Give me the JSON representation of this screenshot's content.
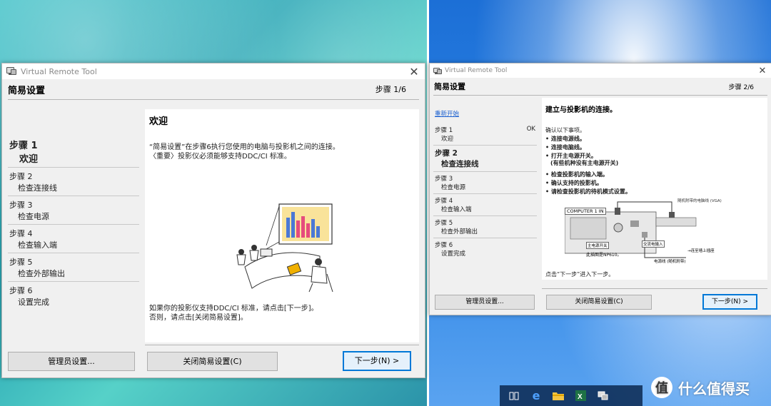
{
  "window_left": {
    "title": "Virtual Remote Tool",
    "header": "简易设置",
    "step_count": "步骤 1/6",
    "sidebar": [
      {
        "step": "步骤 1",
        "label": "欢迎",
        "active": true
      },
      {
        "step": "步骤 2",
        "label": "检查连接线"
      },
      {
        "step": "步骤 3",
        "label": "检查电源"
      },
      {
        "step": "步骤 4",
        "label": "检查输入端"
      },
      {
        "step": "步骤 5",
        "label": "检查外部输出"
      },
      {
        "step": "步骤 6",
        "label": "设置完成"
      }
    ],
    "content": {
      "heading": "欢迎",
      "intro_line1": "“简易设置”在步骤6执行您使用的电脑与投影机之间的连接。",
      "intro_line2": "〈重要〉投影仪必须能够支持DDC/CI 标准。",
      "bottom_line1": "如果你的投影仪支持DDC/CI 标准，请点击[下一步]。",
      "bottom_line2": "否则，请点击[关闭简易设置]。"
    },
    "buttons": {
      "admin": "管理员设置...",
      "close_setup": "关闭简易设置(C)",
      "next": "下一步(N) >"
    }
  },
  "window_right": {
    "title": "Virtual Remote Tool",
    "header": "简易设置",
    "step_count": "步骤 2/6",
    "restart_link": "重新开始",
    "sidebar": [
      {
        "step": "步骤 1",
        "label": "欢迎",
        "status": "OK"
      },
      {
        "step": "步骤 2",
        "label": "检查连接线",
        "active": true
      },
      {
        "step": "步骤 3",
        "label": "检查电源"
      },
      {
        "step": "步骤 4",
        "label": "检查输入端"
      },
      {
        "step": "步骤 5",
        "label": "检查外部输出"
      },
      {
        "step": "步骤 6",
        "label": "设置完成"
      }
    ],
    "content": {
      "heading": "建立与投影机的连接。",
      "confirm_intro": "确认以下事项。",
      "checklist": [
        "• 连接电源线。",
        "• 连接电脑线。",
        "• 打开主电源开关。",
        "(有些机种没有主电源开关)",
        "• 检查投影机的输入端。",
        "• 确认支持的投影机。",
        "• 请检查投影机的待机模式设置。"
      ],
      "diagram_labels": {
        "computer_in": "COMPUTER 1 IN",
        "vga_cable": "随机附带的电脑线 (VGA)",
        "main_power": "主电源开关",
        "ac_input": "交流电输入",
        "example": "此插图是NP610。",
        "to_outlet": "→连至墙上插座",
        "power_cord": "电源线 (随机附带)"
      },
      "footer": "点击“下一步”进入下一步。"
    },
    "buttons": {
      "admin": "管理员设置...",
      "close_setup": "关闭简易设置(C)",
      "next": "下一步(N) >"
    }
  },
  "taskbar": {
    "icons": [
      "task-view-icon",
      "edge-icon",
      "file-explorer-icon",
      "excel-icon",
      "virtual-remote-tool-icon"
    ]
  },
  "watermark": {
    "logo": "值",
    "text": "什么值得买"
  }
}
